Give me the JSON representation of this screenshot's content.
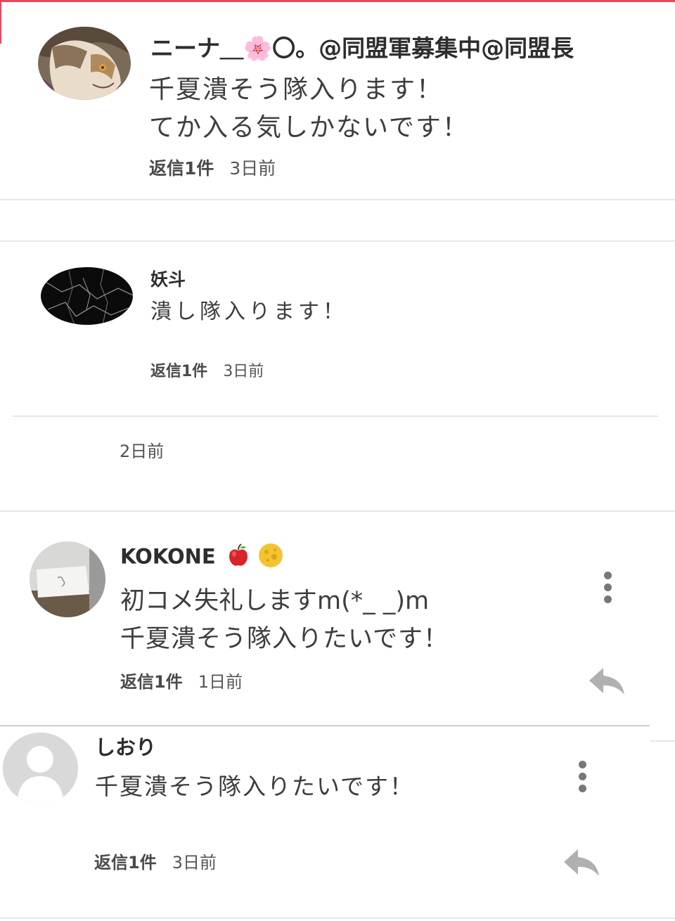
{
  "comments": [
    {
      "username": "ニーナ＿🌸〇。@同盟軍募集中@同盟長",
      "lines": [
        "千夏潰そう隊入ります！",
        "てか入る気しかないです！"
      ],
      "reply_count": "返信1件",
      "time": "3日前",
      "avatar": "anime-character-avatar"
    },
    {
      "username": "妖斗",
      "lines": [
        "潰し隊入ります！"
      ],
      "reply_count": "返信1件",
      "time": "3日前",
      "avatar": "black-marble-avatar"
    },
    {
      "username": "KOKONE",
      "username_emojis": [
        "apple-icon",
        "moon-icon"
      ],
      "lines": [
        "初コメ失礼しますm(*_ _)m",
        "千夏潰そう隊入りたいです！"
      ],
      "reply_count": "返信1件",
      "time": "1日前",
      "avatar": "photo-avatar"
    },
    {
      "username": "しおり",
      "lines": [
        "千夏潰そう隊入りたいです！"
      ],
      "reply_count": "返信1件",
      "time": "3日前",
      "avatar": "default-user-avatar"
    }
  ],
  "standalone_time": "2日前",
  "icons": {
    "more": "kebab-menu-icon",
    "reply": "reply-arrow-icon"
  },
  "colors": {
    "accent": "#e8495a",
    "divider": "#e6e6e6",
    "icon_gray": "#777777",
    "reply_arrow": "#b0b0b0"
  }
}
